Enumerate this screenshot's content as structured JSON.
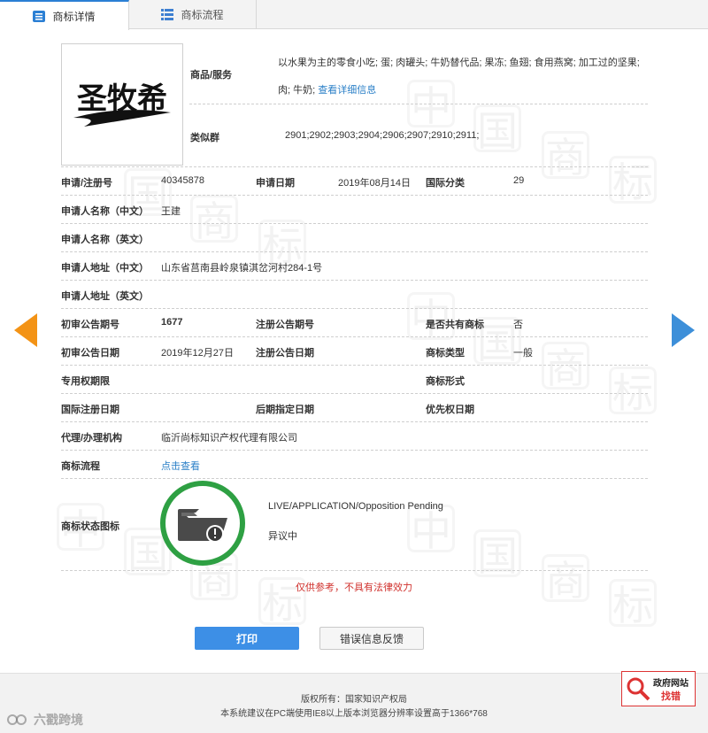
{
  "tabs": [
    {
      "label": "商标详情",
      "icon": "detail-list-icon"
    },
    {
      "label": "商标流程",
      "icon": "flow-list-icon"
    }
  ],
  "logo": {
    "text": "圣牧希"
  },
  "goods": {
    "label": "商品/服务",
    "line1": "以水果为主的零食小吃; 蛋; 肉罐头; 牛奶替代品; 果冻; 鱼翅; 食用燕窝; 加工过的坚果;",
    "line2": "肉; 牛奶;",
    "more_link": "查看详细信息"
  },
  "similar": {
    "label": "类似群",
    "value": "2901;2902;2903;2904;2906;2907;2910;2911;"
  },
  "fields": {
    "reg_no_label": "申请/注册号",
    "reg_no": "40345878",
    "apply_date_label": "申请日期",
    "apply_date": "2019年08月14日",
    "intl_class_label": "国际分类",
    "intl_class": "29",
    "applicant_cn_label": "申请人名称（中文）",
    "applicant_cn": "王建",
    "applicant_en_label": "申请人名称（英文）",
    "address_cn_label": "申请人地址（中文）",
    "address_cn": "山东省莒南县岭泉镇淇岔河村284-1号",
    "address_en_label": "申请人地址（英文）",
    "prelim_no_label": "初审公告期号",
    "prelim_no": "1677",
    "reg_notice_no_label": "注册公告期号",
    "shared_label": "是否共有商标",
    "shared": "否",
    "prelim_date_label": "初审公告日期",
    "prelim_date": "2019年12月27日",
    "reg_notice_date_label": "注册公告日期",
    "mark_type_label": "商标类型",
    "mark_type": "一般",
    "exclusive_period_label": "专用权期限",
    "mark_form_label": "商标形式",
    "intl_reg_date_label": "国际注册日期",
    "later_date_label": "后期指定日期",
    "priority_date_label": "优先权日期",
    "agent_label": "代理/办理机构",
    "agent": "临沂尚标知识产权代理有限公司",
    "flow_label": "商标流程",
    "flow_link": "点击查看",
    "status_icon_label": "商标状态图标",
    "status_en": "LIVE/APPLICATION/Opposition Pending",
    "status_cn": "异议中"
  },
  "disclaimer": "仅供参考，不具有法律效力",
  "buttons": {
    "print": "打印",
    "feedback": "错误信息反馈"
  },
  "footer": {
    "copyright": "版权所有：国家知识产权局",
    "advice": "本系统建议在PC端使用IE8以上版本浏览器分辨率设置高于1366*768"
  },
  "gov_badge": {
    "line1": "政府网站",
    "line2": "找错"
  },
  "corner_watermark": "六戳跨境",
  "colors": {
    "accent": "#2b7fd4",
    "prev_arrow": "#f39316",
    "next_arrow": "#3d8fd9",
    "status_ring": "#2ea043",
    "disclaimer": "#d0312d"
  }
}
